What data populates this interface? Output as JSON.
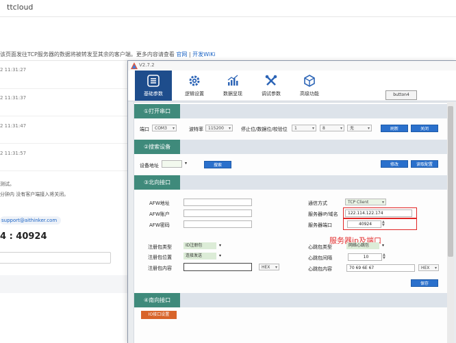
{
  "background_page": {
    "title": "ttcloud",
    "notice_prefix": "该页面发往TCP服务器的数据将被转发至其余的客户端。更多内容请查看",
    "notice_link1": "官网",
    "notice_sep": "|",
    "notice_link2": "开发WiKi",
    "log_times": [
      "2 11:31:27",
      "2 11:31:37",
      "2 11:31:47",
      "2 11:31:57"
    ],
    "msg1": "测试。",
    "msg2": "分钟内 没有客户端接入将关闭。",
    "email": "support@aithinker.com",
    "ip_port": "4 : 40924"
  },
  "window": {
    "title": "V2.7.2",
    "toolbar": {
      "tabs": [
        {
          "label": "基础参数",
          "icon": "list-icon"
        },
        {
          "label": "逻辑设置",
          "icon": "gear-icon"
        },
        {
          "label": "数据呈现",
          "icon": "chart-icon"
        },
        {
          "label": "调试参数",
          "icon": "tools-icon"
        },
        {
          "label": "高级功能",
          "icon": "hexagon-icon"
        }
      ],
      "button4": "button4"
    },
    "serial": {
      "header": "①打开串口",
      "port_label": "端口",
      "port_value": "COM3",
      "baud_label": "波特率",
      "baud_value": "115200",
      "bits_label": "停止位/数据位/校验位",
      "stop_value": "1",
      "data_value": "8",
      "parity_value": "无",
      "refresh_btn": "刷新",
      "close_btn": "关闭"
    },
    "search": {
      "header": "②搜索设备",
      "addr_label": "设备地址",
      "search_btn": "搜索",
      "modify_btn": "修改",
      "read_btn": "读取配置"
    },
    "north": {
      "header": "③北向接口",
      "afw_addr_label": "AFW地址",
      "afw_user_label": "AFW账户",
      "afw_pwd_label": "AFW密码",
      "protocol_label": "通信方式",
      "protocol_value": "TCP Client",
      "server_label": "服务器IP/域名",
      "server_value": "122.114.122.174",
      "port_label": "服务器端口",
      "port_value": "40924",
      "annotation": "服务器ip及端口",
      "reg_type_label": "注册包类型",
      "reg_type_value": "ID注册包",
      "reg_pos_label": "注册包位置",
      "reg_pos_value": "连接发送",
      "reg_content_label": "注册包内容",
      "hex1": "HEX",
      "hb_type_label": "心跳包类型",
      "hb_type_value": "网络心跳包",
      "hb_interval_label": "心跳包间隔",
      "hb_interval_value": "10",
      "hb_content_label": "心跳包内容",
      "hb_content_value": "70 69 6E 67",
      "hex2": "HEX",
      "save_btn": "保存"
    },
    "south": {
      "header": "④南向接口",
      "io_btn": "IO接口设置"
    }
  },
  "colors": {
    "accent": "#2a70cc",
    "section": "#3f8a7b",
    "toolbar_active": "#1e4d8c",
    "highlight": "#e12424"
  }
}
